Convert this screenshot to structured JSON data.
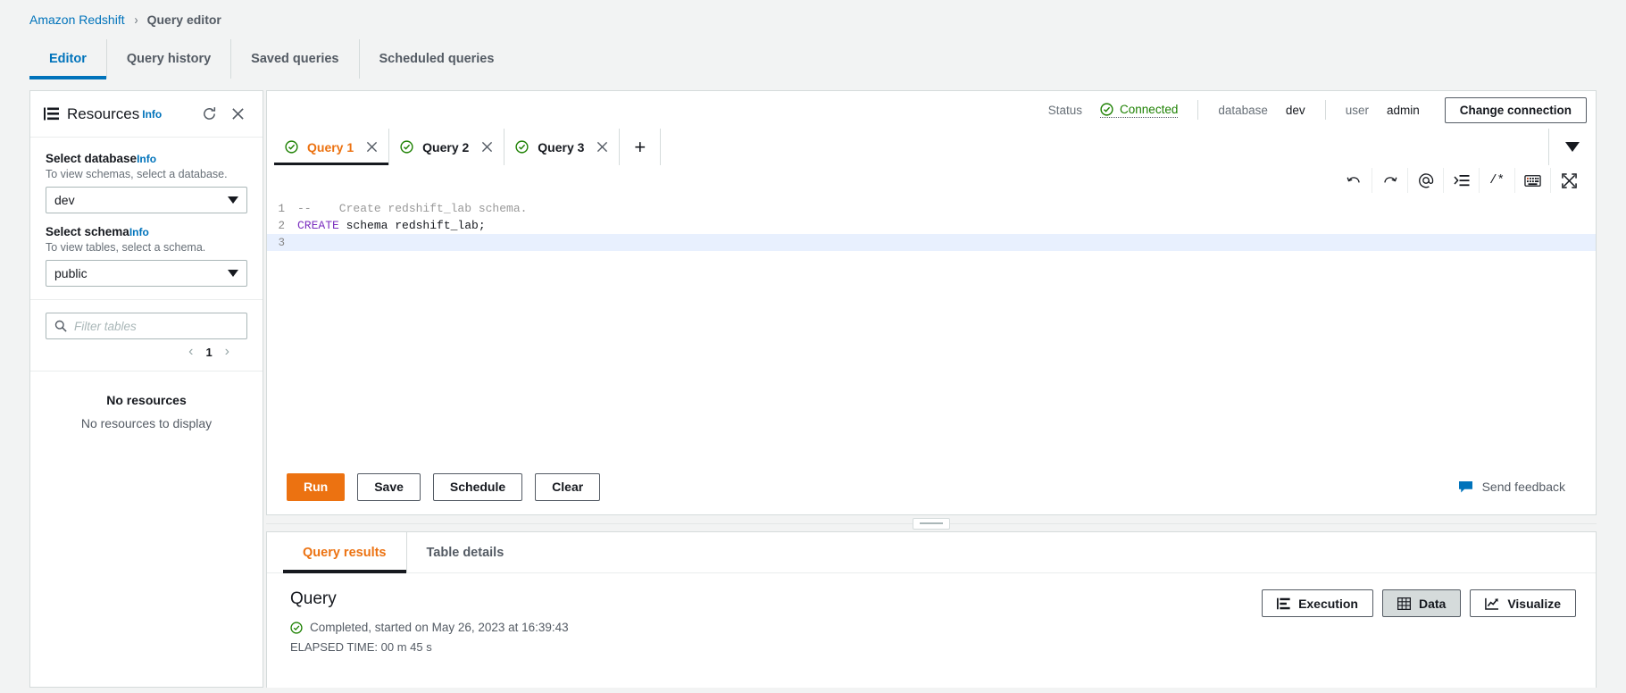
{
  "breadcrumb": {
    "root": "Amazon Redshift",
    "separator": "›",
    "current": "Query editor"
  },
  "top_tabs": [
    {
      "label": "Editor",
      "active": true
    },
    {
      "label": "Query history",
      "active": false
    },
    {
      "label": "Saved queries",
      "active": false
    },
    {
      "label": "Scheduled queries",
      "active": false
    }
  ],
  "sidebar": {
    "title": "Resources",
    "info_label": "Info",
    "refresh_icon": "refresh-icon",
    "close_icon": "close-icon",
    "database_field": {
      "label": "Select database",
      "info_label": "Info",
      "hint": "To view schemas, select a database.",
      "value": "dev"
    },
    "schema_field": {
      "label": "Select schema",
      "info_label": "Info",
      "hint": "To view tables, select a schema.",
      "value": "public"
    },
    "filter": {
      "placeholder": "Filter tables",
      "value": "",
      "icon": "search-icon"
    },
    "pagination": {
      "prev": "‹",
      "page": "1",
      "next": "›"
    },
    "empty_state": {
      "title": "No resources",
      "subtitle": "No resources to display"
    }
  },
  "connection_bar": {
    "status_label": "Status",
    "status_value": "Connected",
    "database_label": "database",
    "database_value": "dev",
    "user_label": "user",
    "user_value": "admin",
    "change_connection_label": "Change connection"
  },
  "query_tabs": {
    "tabs": [
      {
        "label": "Query 1",
        "active": true,
        "status_icon": "check-circle-icon",
        "close_icon": "close-icon"
      },
      {
        "label": "Query 2",
        "active": false,
        "status_icon": "check-circle-icon",
        "close_icon": "close-icon"
      },
      {
        "label": "Query 3",
        "active": false,
        "status_icon": "check-circle-icon",
        "close_icon": "close-icon"
      }
    ],
    "add_label": "+",
    "dropdown_icon": "chevron-down-icon"
  },
  "editor_toolbar": [
    {
      "name": "undo-icon",
      "title": "Undo"
    },
    {
      "name": "redo-icon",
      "title": "Redo"
    },
    {
      "name": "at-sign-icon",
      "title": "Parameters"
    },
    {
      "name": "indent-icon",
      "title": "Format"
    },
    {
      "name": "comment-icon",
      "title": "Comment",
      "glyph": "/*"
    },
    {
      "name": "keyboard-icon",
      "title": "Shortcuts"
    },
    {
      "name": "expand-icon",
      "title": "Full screen"
    }
  ],
  "code": {
    "lines": [
      {
        "number": "1",
        "highlighted": false,
        "tokens": [
          {
            "type": "comment",
            "text": "--    Create redshift_lab schema."
          }
        ]
      },
      {
        "number": "2",
        "highlighted": false,
        "tokens": [
          {
            "type": "keyword",
            "text": "CREATE"
          },
          {
            "type": "plain",
            "text": " schema redshift_lab;"
          }
        ]
      },
      {
        "number": "3",
        "highlighted": true,
        "tokens": [
          {
            "type": "plain",
            "text": ""
          }
        ]
      }
    ]
  },
  "actions": {
    "run_label": "Run",
    "save_label": "Save",
    "schedule_label": "Schedule",
    "clear_label": "Clear",
    "feedback_label": "Send feedback",
    "feedback_icon": "speech-bubble-icon"
  },
  "results": {
    "tabs": [
      {
        "label": "Query results",
        "active": true
      },
      {
        "label": "Table details",
        "active": false
      }
    ],
    "title": "Query",
    "status_icon": "check-circle-icon",
    "status_text": "Completed, started on May 26, 2023 at 16:39:43",
    "elapsed_text": "ELAPSED TIME: 00 m 45 s",
    "view_buttons": [
      {
        "label": "Execution",
        "icon": "execution-icon",
        "selected": false
      },
      {
        "label": "Data",
        "icon": "table-grid-icon",
        "selected": true
      },
      {
        "label": "Visualize",
        "icon": "line-chart-icon",
        "selected": false
      }
    ]
  },
  "colors": {
    "accent_orange": "#ec7211",
    "link_blue": "#0073bb",
    "success_green": "#1d8102",
    "page_bg": "#f2f3f3",
    "border": "#d5dbdb"
  }
}
